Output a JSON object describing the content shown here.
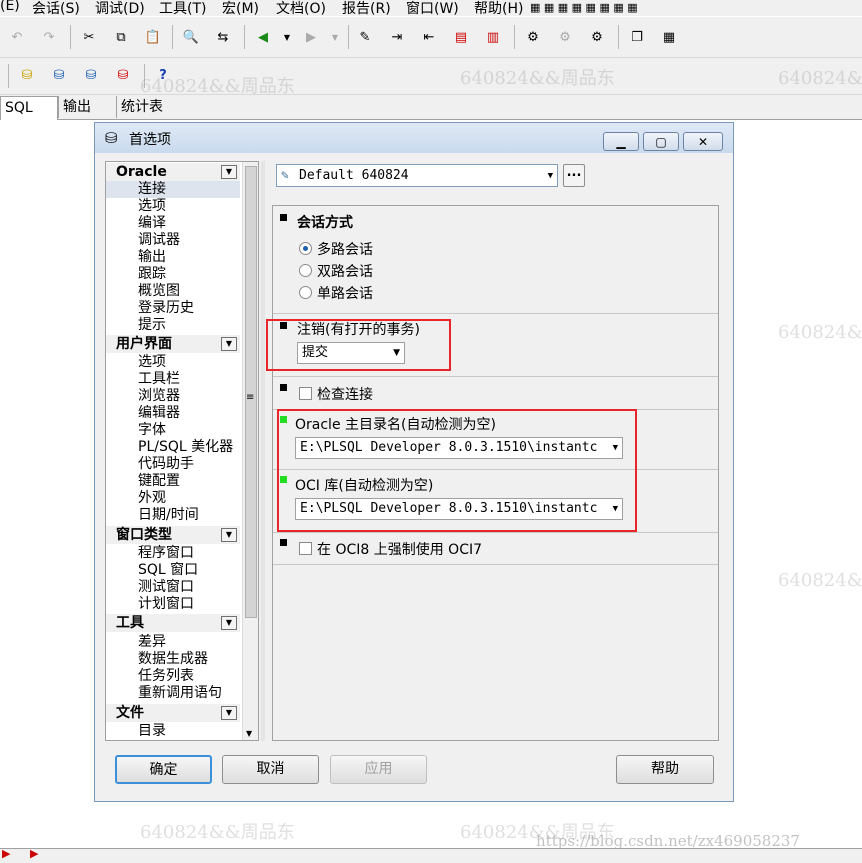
{
  "menu": [
    "(E)",
    "会话(S)",
    "调试(D)",
    "工具(T)",
    "宏(M)",
    "文档(O)",
    "报告(R)",
    "窗口(W)",
    "帮助(H)"
  ],
  "tabs": [
    "SQL",
    "输出",
    "统计表"
  ],
  "dialog": {
    "title": "首选项",
    "profile_value": "Default 640824",
    "profile_more": "...",
    "ok_label": "确定",
    "cancel_label": "取消",
    "apply_label": "应用",
    "help_label": "帮助"
  },
  "tree": {
    "oracle": {
      "header": "Oracle",
      "items": [
        "连接",
        "选项",
        "编译",
        "调试器",
        "输出",
        "跟踪",
        "概览图",
        "登录历史",
        "提示"
      ]
    },
    "ui": {
      "header": "用户界面",
      "items": [
        "选项",
        "工具栏",
        "浏览器",
        "编辑器",
        "字体",
        "PL/SQL 美化器",
        "代码助手",
        "键配置",
        "外观",
        "日期/时间"
      ]
    },
    "wintype": {
      "header": "窗口类型",
      "items": [
        "程序窗口",
        "SQL 窗口",
        "测试窗口",
        "计划窗口"
      ]
    },
    "tools": {
      "header": "工具",
      "items": [
        "差异",
        "数据生成器",
        "任务列表",
        "重新调用语句"
      ]
    },
    "file": {
      "header": "文件",
      "items": [
        "目录"
      ]
    }
  },
  "session": {
    "title": "会话方式",
    "options": [
      "多路会话",
      "双路会话",
      "单路会话"
    ],
    "selected": "多路会话"
  },
  "logoff": {
    "label": "注销(有打开的事务)",
    "value": "提交"
  },
  "check_connection": {
    "label": "检查连接",
    "checked": false
  },
  "oracle_home": {
    "label": "Oracle 主目录名(自动检测为空)",
    "value": "E:\\PLSQL Developer 8.0.3.1510\\instantc"
  },
  "oci_library": {
    "label": "OCI 库(自动检测为空)",
    "value": "E:\\PLSQL Developer 8.0.3.1510\\instantc"
  },
  "force_oci7": {
    "label": "在 OCI8 上强制使用 OCI7",
    "checked": false
  },
  "watermark": {
    "text": "640824&&周品东",
    "url": "https://blog.csdn.net/zx469058237"
  },
  "colors": {
    "highlight": "#e8252b",
    "accent": "#3c8fd9",
    "changed_marker": "#22dd22"
  }
}
